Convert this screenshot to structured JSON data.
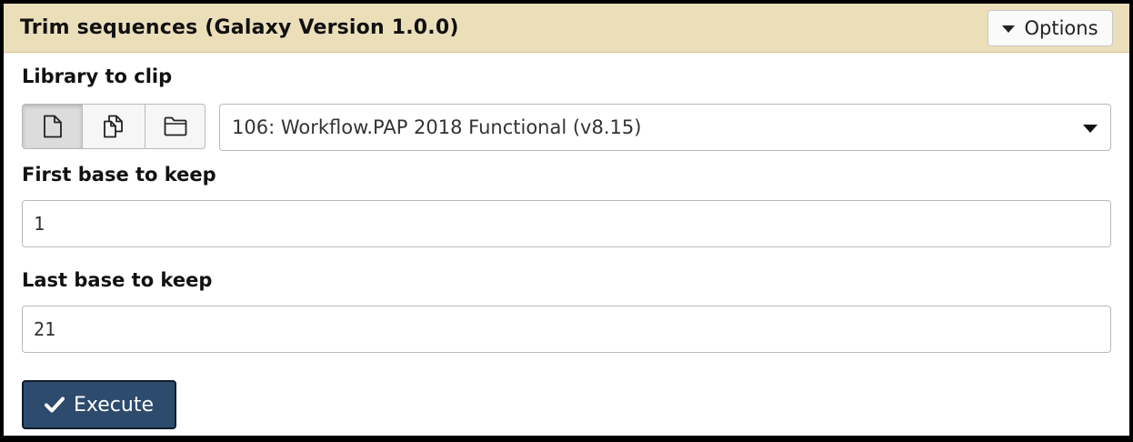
{
  "header": {
    "title": "Trim sequences (Galaxy Version 1.0.0)",
    "options_label": "Options"
  },
  "form": {
    "library": {
      "label": "Library to clip",
      "input_modes": [
        {
          "icon": "single-file-icon",
          "active": true
        },
        {
          "icon": "multiple-files-icon",
          "active": false
        },
        {
          "icon": "folder-icon",
          "active": false
        }
      ],
      "selected_value": "106: Workflow.PAP 2018 Functional (v8.15)"
    },
    "first_base": {
      "label": "First base to keep",
      "value": "1"
    },
    "last_base": {
      "label": "Last base to keep",
      "value": "21"
    }
  },
  "actions": {
    "execute_label": "Execute",
    "execute_icon": "check-icon"
  },
  "colors": {
    "header_bg": "#ebdfba",
    "execute_bg": "#2c4b6d"
  }
}
